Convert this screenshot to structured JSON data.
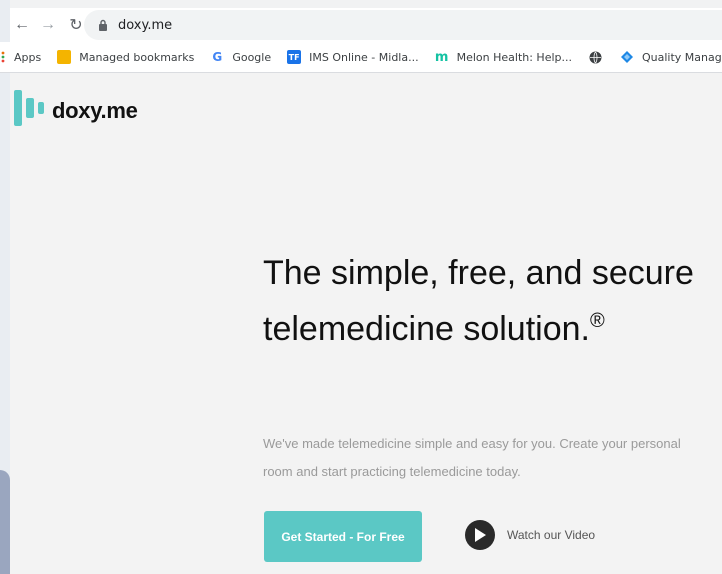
{
  "browser": {
    "url": "doxy.me",
    "bookmarks": [
      {
        "label": "Apps",
        "icon": "apps-grid-icon",
        "color": "#e8710a"
      },
      {
        "label": "Managed bookmarks",
        "icon": "folder-icon",
        "color": "#f4b400"
      },
      {
        "label": "Google",
        "icon": "google-icon",
        "color": "#4285f4"
      },
      {
        "label": "IMS Online - Midla...",
        "icon": "ims-icon",
        "color": "#1a73e8"
      },
      {
        "label": "Melon Health: Help...",
        "icon": "melon-icon",
        "color": "#14c2a3"
      },
      {
        "label": "",
        "icon": "globe-icon",
        "color": "#3c4043"
      },
      {
        "label": "Quality Manageme...",
        "icon": "diamond-icon",
        "color": "#1e88e5"
      }
    ]
  },
  "page": {
    "logo_text": "doxy.me",
    "headline": "The simple, free, and secure telemedicine solution.",
    "headline_mark": "®",
    "subtext": "We've made telemedicine simple and easy for you. Create your personal room and start practicing telemedicine today.",
    "cta_label": "Get Started - For Free",
    "video_label": "Watch our Video"
  },
  "colors": {
    "accent": "#5bc8c5",
    "logo": "#5bc8c5"
  }
}
